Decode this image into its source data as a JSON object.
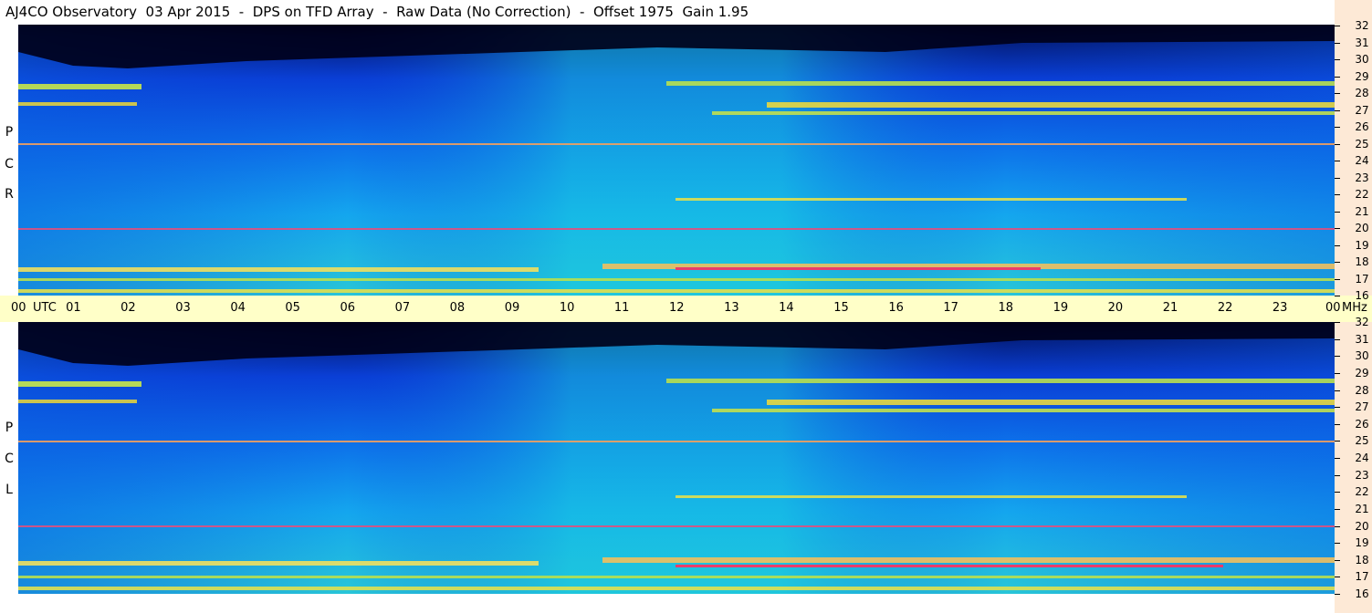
{
  "title": "AJ4CO Observatory  03 Apr 2015  -  DPS on TFD Array  -  Raw Data (No Correction)  -  Offset 1975  Gain 1.95",
  "panels": [
    {
      "name": "rcp",
      "letters": [
        "R",
        "C",
        "P"
      ]
    },
    {
      "name": "lcp",
      "letters": [
        "L",
        "C",
        "P"
      ]
    }
  ],
  "freq_axis": {
    "unit": "MHz",
    "ticks": [
      "32",
      "31",
      "30",
      "29",
      "28",
      "27",
      "26",
      "25",
      "24",
      "23",
      "22",
      "21",
      "20",
      "19",
      "18",
      "17",
      "16"
    ]
  },
  "time_axis": {
    "start_label": "00",
    "utc_label": "UTC",
    "hours": [
      "01",
      "02",
      "03",
      "04",
      "05",
      "06",
      "07",
      "08",
      "09",
      "10",
      "11",
      "12",
      "13",
      "14",
      "15",
      "16",
      "17",
      "18",
      "19",
      "20",
      "21",
      "22",
      "23"
    ],
    "end_label": "00",
    "mhz_label": "MHz"
  },
  "colors": {
    "background": "#ffffff",
    "axis_band": "#ffffc8",
    "freq_strip": "#fde9d6"
  }
}
